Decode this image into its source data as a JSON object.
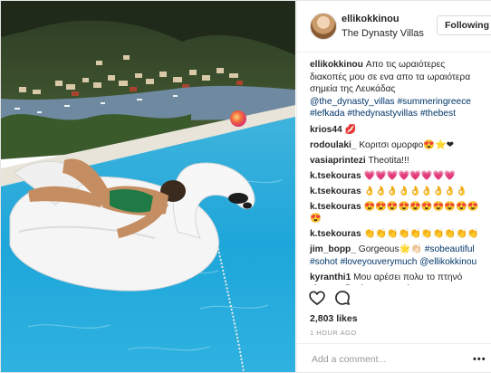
{
  "post": {
    "username": "ellikokkinou",
    "location": "The Dynasty Villas",
    "follow_label": "Following"
  },
  "comments": [
    {
      "user": "ellikokkinou",
      "text": "Απο τις ωραιότερες διακοπές μου σε ενα απο τα ωραιότερα σημεία της Λευκάδας",
      "tags": [
        "@the_dynasty_villas",
        "#summeringreece",
        "#lefkada",
        "#thedynastyvillas",
        "#thebest"
      ]
    },
    {
      "user": "krios44",
      "text": "💋"
    },
    {
      "user": "rodoulaki_",
      "text": "Κοριτσι ομορφο😍⭐❤"
    },
    {
      "user": "vasiaprintezi",
      "text": "Theotita!!!"
    },
    {
      "user": "k.tsekouras",
      "text": "💗💗💗💗💗💗💗💗"
    },
    {
      "user": "k.tsekouras",
      "text": "👌👌👌👌👌👌👌👌👌"
    },
    {
      "user": "k.tsekouras",
      "text": "😍😍😍😍😍😍😍😍😍😍😍"
    },
    {
      "user": "k.tsekouras",
      "text": "👏👏👏👏👏👏👏👏👏👏"
    },
    {
      "user": "jim_bopp_",
      "text": "Gorgeous🌟👏🏻",
      "tags": [
        "#sobeautiful",
        "#sohot",
        "#loveyouverymuch",
        "@ellikokkinou"
      ]
    },
    {
      "user": "kyranthi1",
      "text": "Μου αρέσει πολυ το πτηνό είναι και δεμένο...ΘΕΑ είσαι! Χαχαχαχα Να περνάς όμορφα κ Χρόνια Σου πολλά για"
    }
  ],
  "likes": "2,803 likes",
  "time_ago": "1 HOUR AGO",
  "comment_input": {
    "placeholder": "Add a comment..."
  },
  "more_label": "•••",
  "icons": {
    "like": "heart-icon",
    "comment": "comment-icon",
    "more": "more-options-icon"
  },
  "colors": {
    "link": "#003569",
    "border": "#e6e6e6",
    "muted": "#999999",
    "text": "#262626"
  }
}
